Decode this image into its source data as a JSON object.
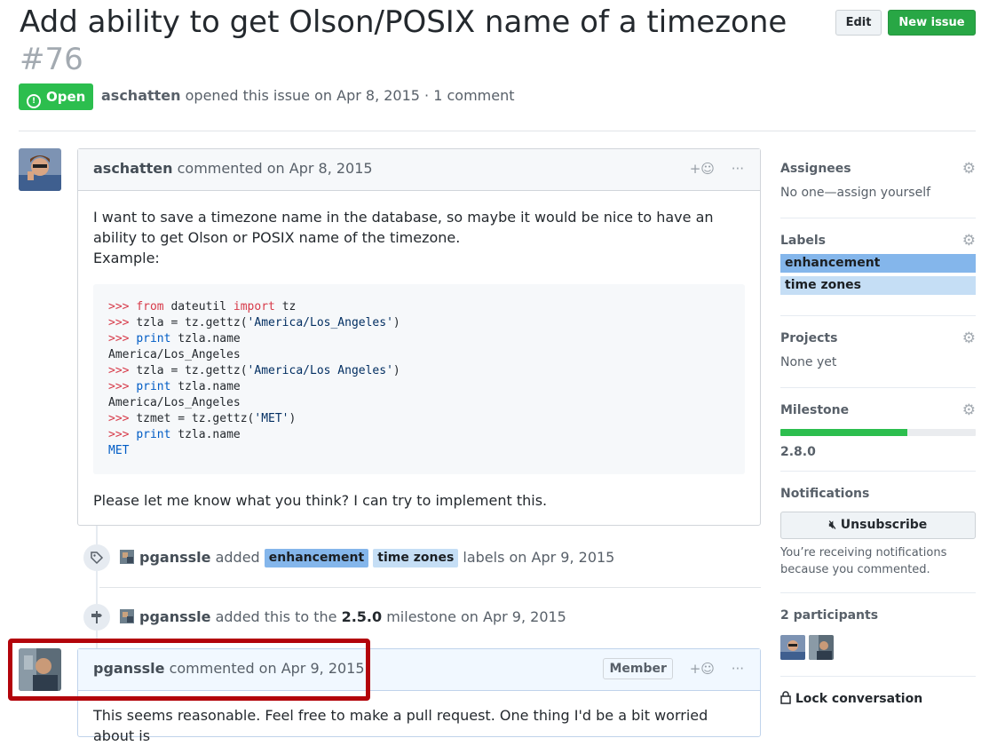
{
  "issue": {
    "title": "Add ability to get Olson/POSIX name of a timezone",
    "number": "#76",
    "state": "Open",
    "author": "aschatten",
    "meta_suffix": "opened this issue on Apr 8, 2015 · 1 comment"
  },
  "header_buttons": {
    "edit": "Edit",
    "new_issue": "New issue"
  },
  "comment1": {
    "author": "aschatten",
    "date_text": "commented on Apr 8, 2015",
    "add_reaction": "+☺",
    "more": "···",
    "para1": "I want to save a timezone name in the database, so maybe it would be nice to have an ability to get Olson or POSIX name of the timezone.",
    "para2": "Example:",
    "code_lines": [
      [
        {
          "t": ">>> ",
          "c": "p"
        },
        {
          "t": "from",
          "c": "p"
        },
        {
          "t": " dateutil ",
          "c": ""
        },
        {
          "t": "import",
          "c": "p"
        },
        {
          "t": " tz",
          "c": ""
        }
      ],
      [
        {
          "t": ">>> ",
          "c": "p"
        },
        {
          "t": "tzla = tz.gettz(",
          "c": ""
        },
        {
          "t": "'America/Los_Angeles'",
          "c": "s"
        },
        {
          "t": ")",
          "c": ""
        }
      ],
      [
        {
          "t": ">>> ",
          "c": "p"
        },
        {
          "t": "print",
          "c": "b"
        },
        {
          "t": " tzla.name",
          "c": ""
        }
      ],
      [
        {
          "t": "America/Los_Angeles",
          "c": ""
        }
      ],
      [
        {
          "t": ">>> ",
          "c": "p"
        },
        {
          "t": "tzla = tz.gettz(",
          "c": ""
        },
        {
          "t": "'America/Los Angeles'",
          "c": "s"
        },
        {
          "t": ")",
          "c": ""
        }
      ],
      [
        {
          "t": ">>> ",
          "c": "p"
        },
        {
          "t": "print",
          "c": "b"
        },
        {
          "t": " tzla.name",
          "c": ""
        }
      ],
      [
        {
          "t": "America/Los_Angeles",
          "c": ""
        }
      ],
      [
        {
          "t": ">>> ",
          "c": "p"
        },
        {
          "t": "tzmet = tz.gettz(",
          "c": ""
        },
        {
          "t": "'MET'",
          "c": "s"
        },
        {
          "t": ")",
          "c": ""
        }
      ],
      [
        {
          "t": ">>> ",
          "c": "p"
        },
        {
          "t": "print",
          "c": "b"
        },
        {
          "t": " tzla.name",
          "c": ""
        }
      ],
      [
        {
          "t": "MET",
          "c": "b"
        }
      ]
    ],
    "para3": "Please let me know what you think? I can try to implement this."
  },
  "event_labels": {
    "actor": "pganssle",
    "verb": "added",
    "label1": "enhancement",
    "label2": "time zones",
    "suffix": "labels on Apr 9, 2015"
  },
  "event_milestone": {
    "actor": "pganssle",
    "prefix": "added this to the",
    "milestone": "2.5.0",
    "suffix": "milestone on Apr 9, 2015"
  },
  "comment2": {
    "author": "pganssle",
    "date_text": "commented on Apr 9, 2015",
    "role": "Member",
    "add_reaction": "+☺",
    "more": "···",
    "body": "This seems reasonable. Feel free to make a pull request. One thing I'd be a bit worried about is"
  },
  "sidebar": {
    "assignees": {
      "title": "Assignees",
      "value": "No one—assign yourself"
    },
    "labels": {
      "title": "Labels",
      "items": [
        "enhancement",
        "time zones"
      ]
    },
    "projects": {
      "title": "Projects",
      "value": "None yet"
    },
    "milestone": {
      "title": "Milestone",
      "name": "2.8.0",
      "progress": 0.65
    },
    "notifications": {
      "title": "Notifications",
      "button": "Unsubscribe",
      "note": "You’re receiving notifications because you commented."
    },
    "participants": {
      "title": "2 participants"
    },
    "lock": "Lock conversation"
  },
  "colors": {
    "open": "#2cbe4e",
    "enhancement": "#84b6eb",
    "time_zones": "#c5def5",
    "highlight": "#b3040b"
  }
}
